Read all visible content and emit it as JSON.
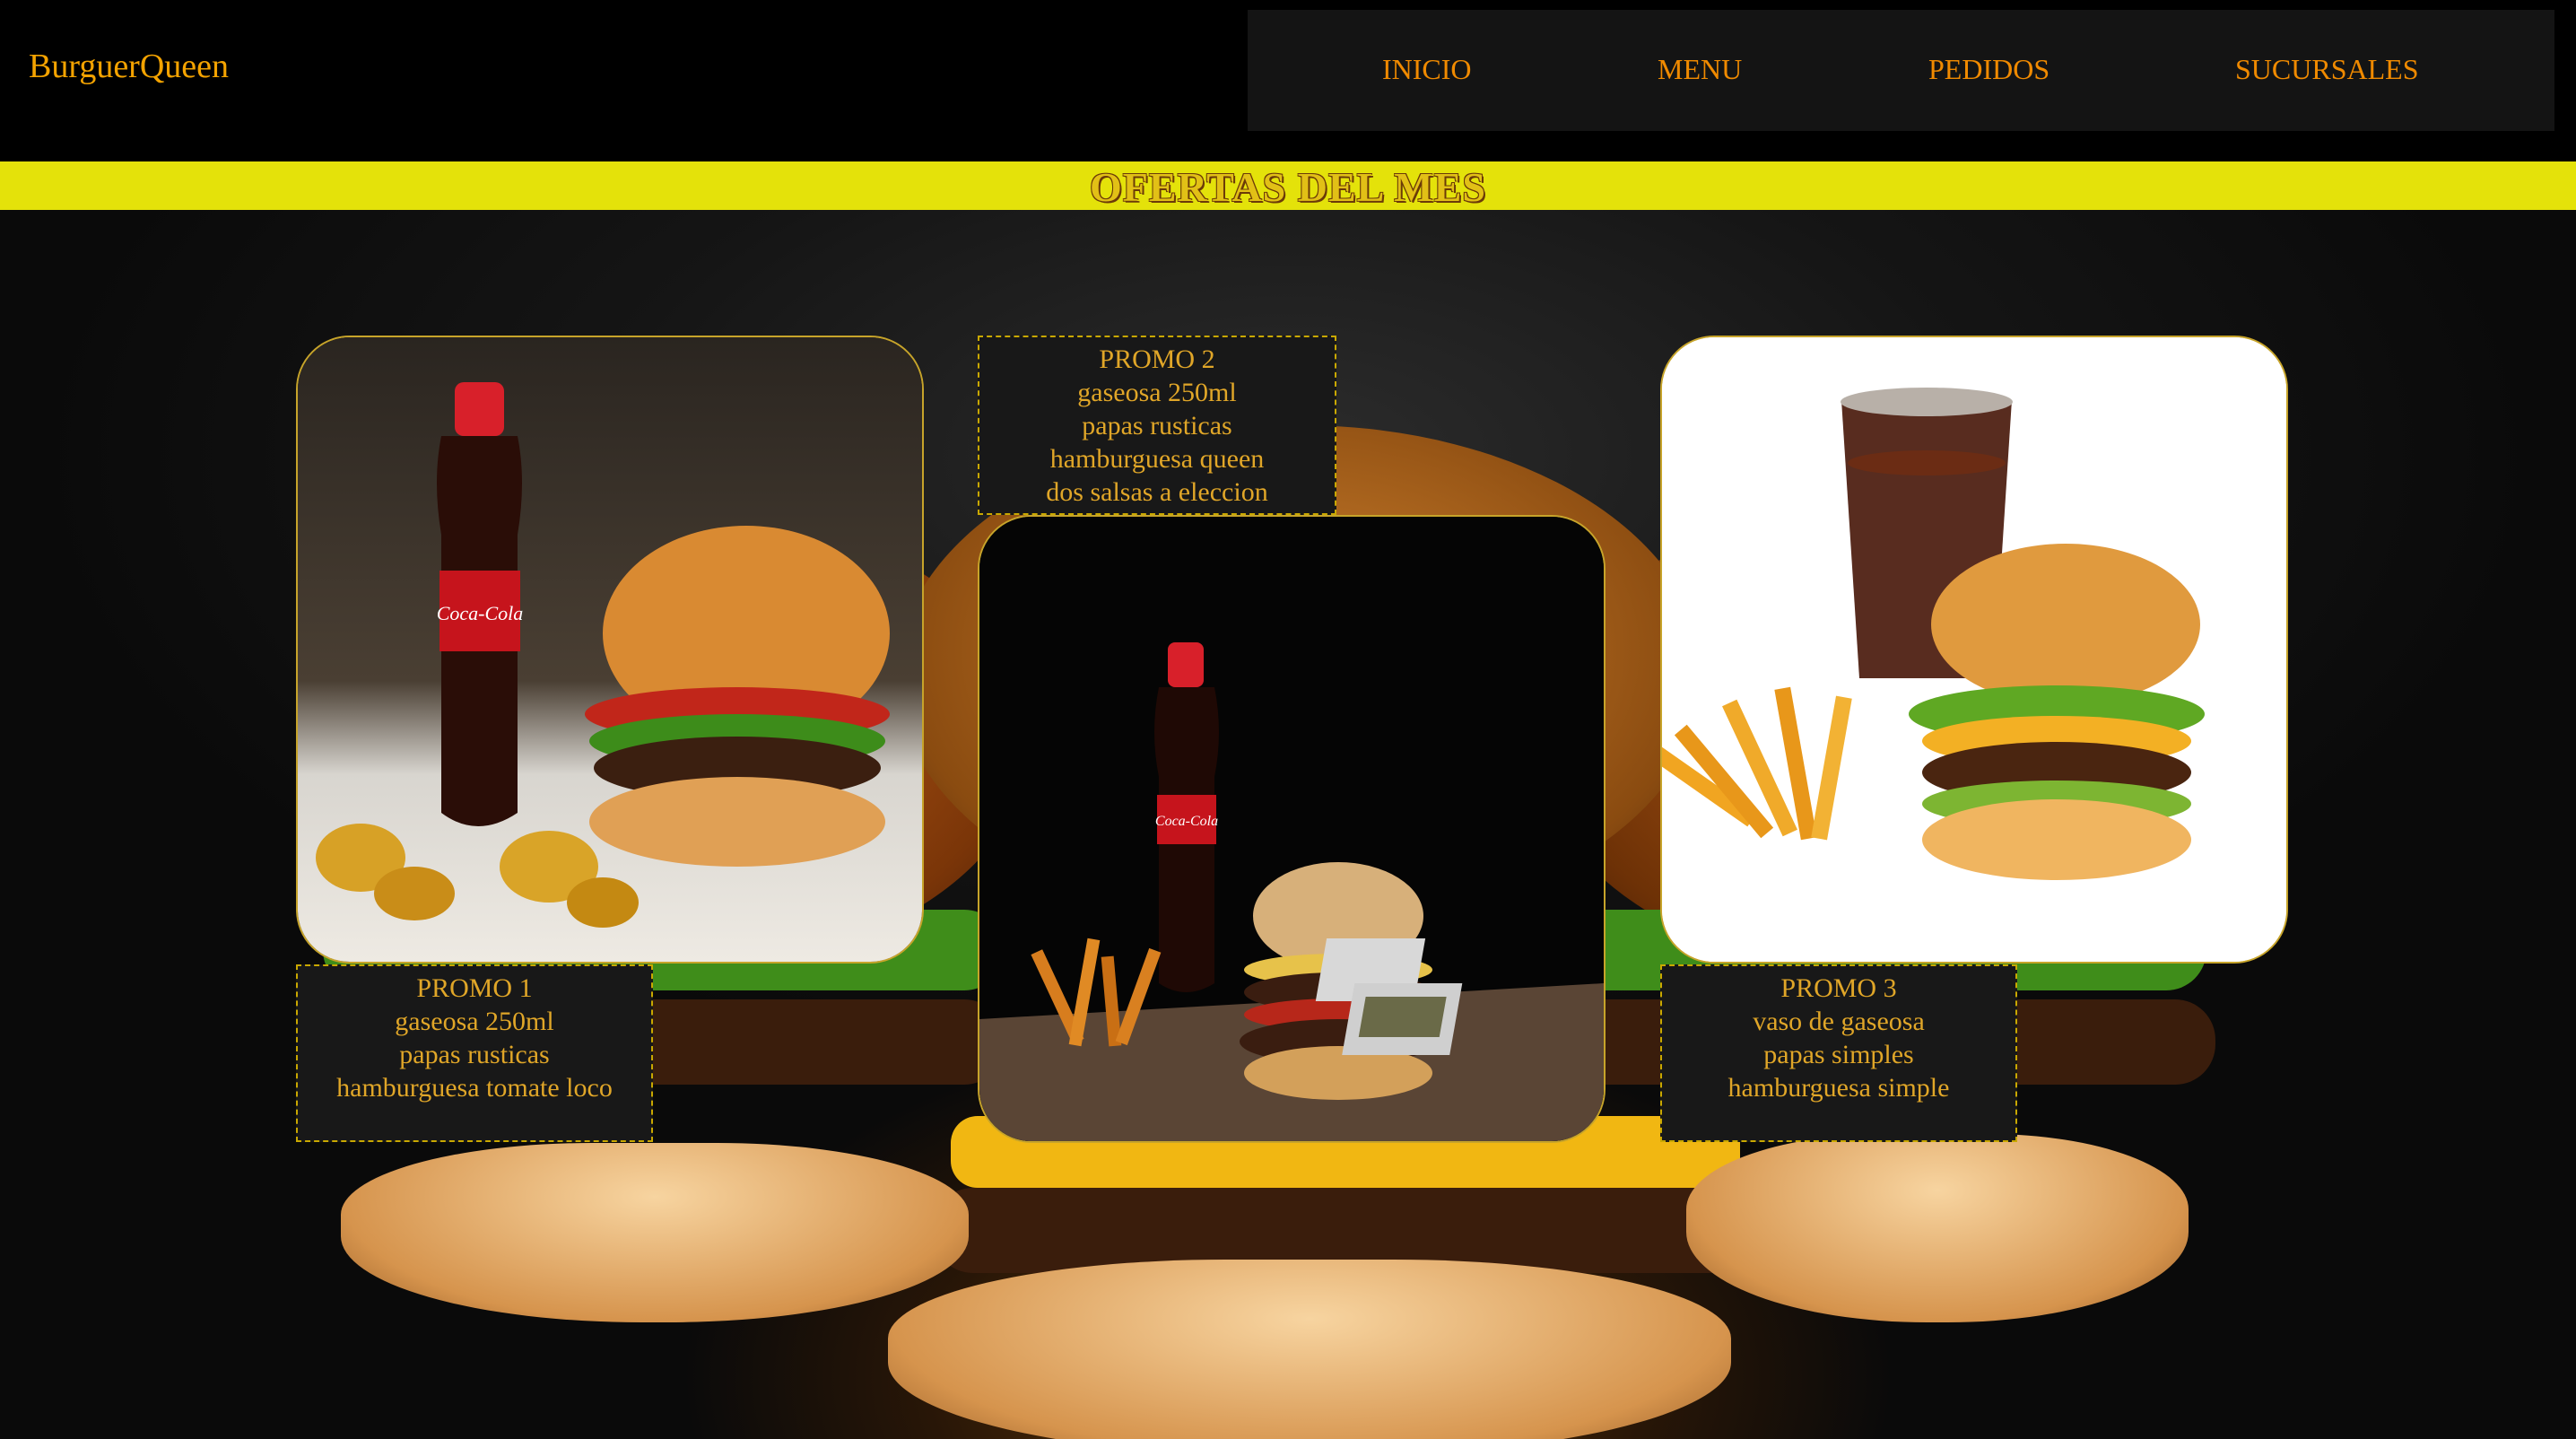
{
  "header": {
    "brand": "BurguerQueen",
    "nav": [
      {
        "label": "INICIO"
      },
      {
        "label": "MENU"
      },
      {
        "label": "PEDIDOS"
      },
      {
        "label": "SUCURSALES"
      }
    ]
  },
  "banner": {
    "title": "OFERTAS DEL MES"
  },
  "promos": [
    {
      "title": "PROMO 1",
      "items": [
        "gaseosa 250ml",
        "papas rusticas",
        "hamburguesa tomate loco"
      ]
    },
    {
      "title": "PROMO 2",
      "items": [
        "gaseosa 250ml",
        "papas rusticas",
        "hamburguesa queen",
        "dos salsas a eleccion"
      ]
    },
    {
      "title": "PROMO 3",
      "items": [
        "vaso de gaseosa",
        "papas simples",
        "hamburguesa simple"
      ]
    }
  ],
  "product_labels": [
    "Coca-Cola",
    "Coca-Cola"
  ],
  "colors": {
    "brand": "#f4a300",
    "nav": "#f08a00",
    "banner": "#e4e20a",
    "card_border": "#c7a42a"
  }
}
